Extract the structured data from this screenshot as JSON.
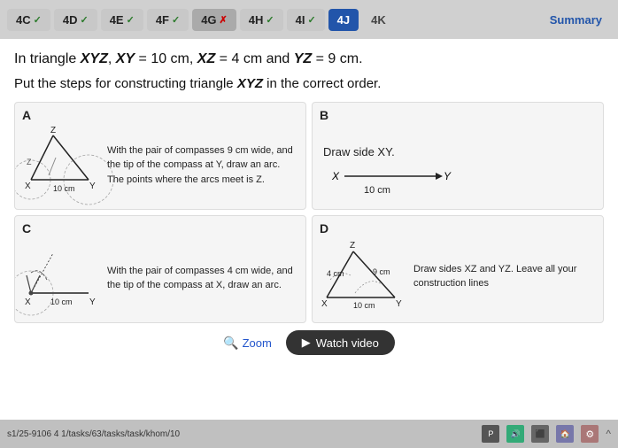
{
  "nav": {
    "items": [
      {
        "id": "4C",
        "label": "4C",
        "status": "check",
        "symbol": "✓"
      },
      {
        "id": "4D",
        "label": "4D",
        "status": "check",
        "symbol": "✓"
      },
      {
        "id": "4E",
        "label": "4E",
        "status": "check",
        "symbol": "✓"
      },
      {
        "id": "4F",
        "label": "4F",
        "status": "check",
        "symbol": "✓"
      },
      {
        "id": "4G",
        "label": "4G",
        "status": "x",
        "symbol": "✗"
      },
      {
        "id": "4H",
        "label": "4H",
        "status": "check",
        "symbol": "✓"
      },
      {
        "id": "4I",
        "label": "4I",
        "status": "check",
        "symbol": "✓"
      },
      {
        "id": "4J",
        "label": "4J",
        "status": "active"
      },
      {
        "id": "4K",
        "label": "4K",
        "status": "plain"
      },
      {
        "id": "Summary",
        "label": "Summary",
        "status": "summary"
      }
    ]
  },
  "problem": {
    "line1": "In triangle XYZ, XY = 10 cm, XZ = 4 cm and YZ = 9 cm.",
    "line2": "Put the steps for constructing triangle XYZ in the correct order."
  },
  "cards": {
    "A": {
      "label": "A",
      "text": "With the pair of compasses 9 cm wide, and the tip of the compass at Y, draw an arc. The points where the arcs meet is Z."
    },
    "B": {
      "label": "B",
      "text": "Draw side XY.",
      "line_label_x": "X",
      "line_label_y": "Y",
      "line_measure": "10 cm"
    },
    "C": {
      "label": "C",
      "text": "With the pair of compasses 4 cm wide, and the tip of the compass at X, draw an arc."
    },
    "D": {
      "label": "D",
      "text": "Draw sides XZ and YZ. Leave all your construction lines",
      "labels": {
        "Z": "Z",
        "X": "X",
        "Y": "Y",
        "left": "4 cm",
        "right": "9 cm",
        "bottom": "10 cm"
      }
    }
  },
  "buttons": {
    "zoom": "Zoom",
    "watch": "Watch video"
  },
  "taskbar": {
    "url": "s1/25-9106 4 1/tasks/63/tasks/task/khom/10"
  }
}
